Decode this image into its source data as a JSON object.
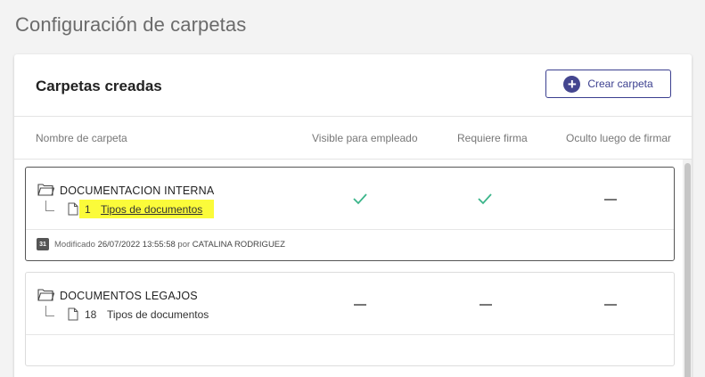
{
  "page": {
    "title": "Configuración de carpetas"
  },
  "card": {
    "title": "Carpetas creadas",
    "create_button_label": "Crear carpeta"
  },
  "columns": {
    "name": "Nombre de carpeta",
    "visible": "Visible para empleado",
    "signature": "Requiere firma",
    "hidden_after_sign": "Oculto luego de firmar"
  },
  "folders": [
    {
      "name": "DOCUMENTACION INTERNA",
      "doc_count": "1",
      "doc_link": "Tipos de documentos",
      "visible": true,
      "signature": true,
      "hidden_after_sign": false,
      "calendar_day": "31",
      "modified_prefix": "Modificado",
      "modified_date": "26/07/2022 13:55:58",
      "modified_by_prefix": "por",
      "modified_by": "CATALINA RODRIGUEZ"
    },
    {
      "name": "DOCUMENTOS LEGAJOS",
      "doc_count": "18",
      "doc_link": "Tipos de documentos",
      "visible": false,
      "signature": false,
      "hidden_after_sign": false
    }
  ],
  "colors": {
    "accent": "#44468f",
    "check": "#3bb58a",
    "highlight": "#fbfb3a"
  }
}
